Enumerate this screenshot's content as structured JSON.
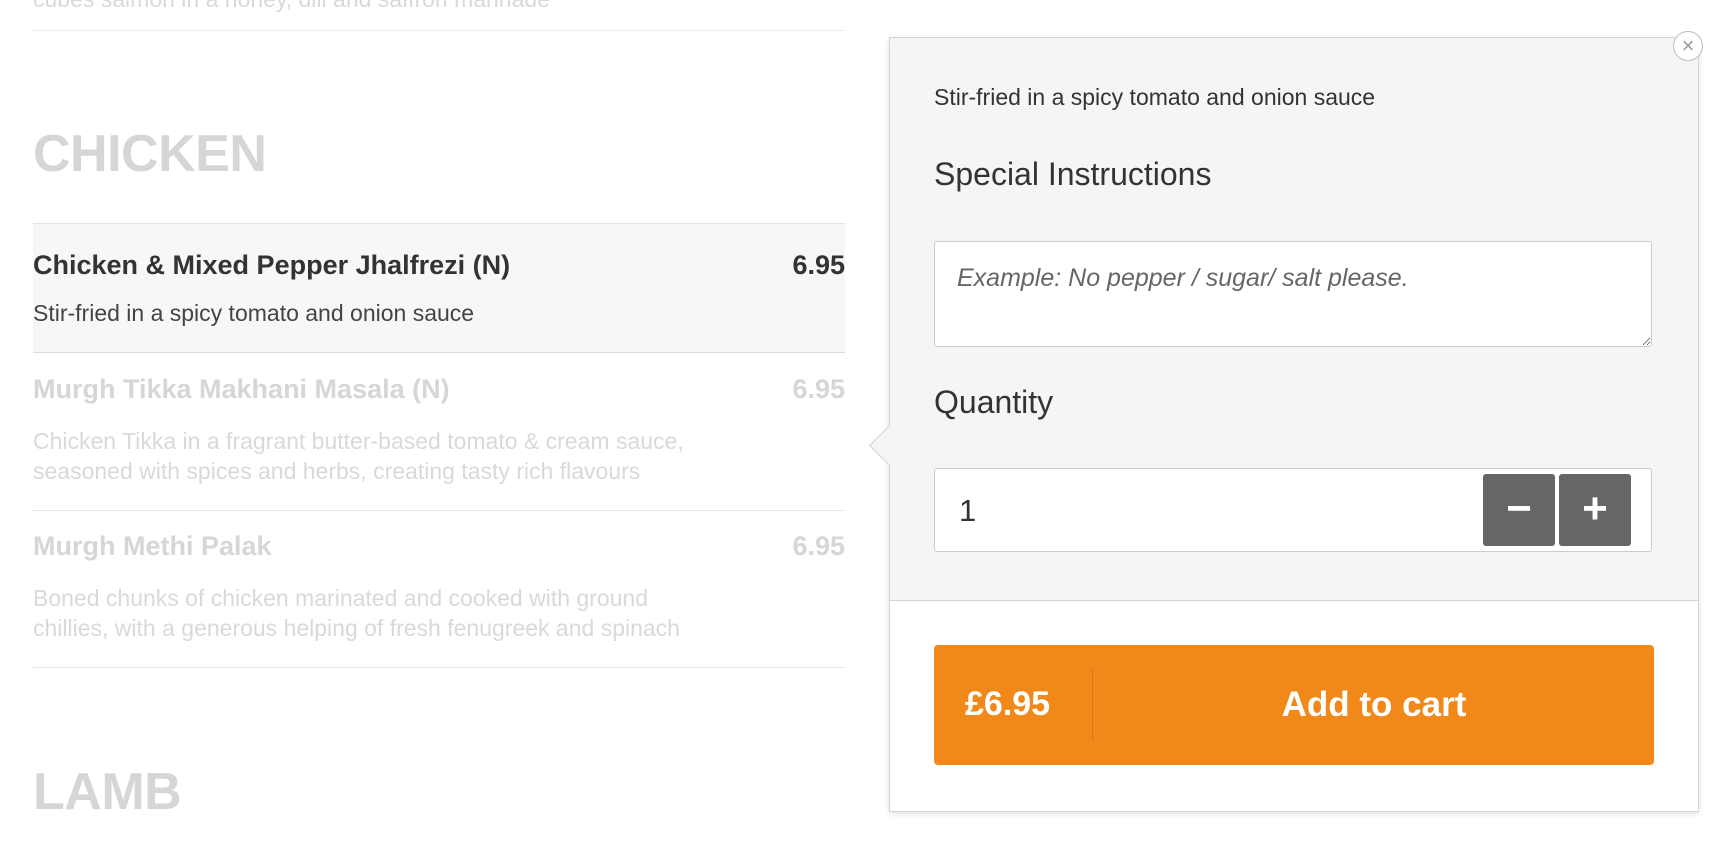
{
  "menu": {
    "top_desc": "cubes salmon in a honey, dill and saffron marinade",
    "sections": [
      "CHICKEN",
      "LAMB"
    ],
    "items": [
      {
        "name": "Chicken & Mixed Pepper Jhalfrezi (N)",
        "price": "6.95",
        "desc": "Stir-fried in a spicy tomato and onion sauce"
      },
      {
        "name": "Murgh Tikka Makhani Masala (N)",
        "price": "6.95",
        "desc_line1": "Chicken Tikka in a fragrant butter-based tomato & cream sauce,",
        "desc_line2": "seasoned with spices and herbs, creating tasty rich flavours"
      },
      {
        "name": "Murgh Methi Palak",
        "price": "6.95",
        "desc_line1": "Boned chunks of chicken marinated and cooked with ground",
        "desc_line2": "chillies, with a generous helping of fresh fenugreek and spinach"
      }
    ]
  },
  "popover": {
    "close_icon": "×",
    "description": "Stir-fried in a spicy tomato and onion sauce",
    "instructions_label": "Special Instructions",
    "instructions_placeholder": "Example: No pepper / sugar/ salt please.",
    "quantity_label": "Quantity",
    "quantity_value": "1",
    "minus_icon": "−",
    "plus_icon": "+",
    "add_button": {
      "price": "£6.95",
      "label": "Add to cart",
      "color": "#f0891a"
    }
  }
}
